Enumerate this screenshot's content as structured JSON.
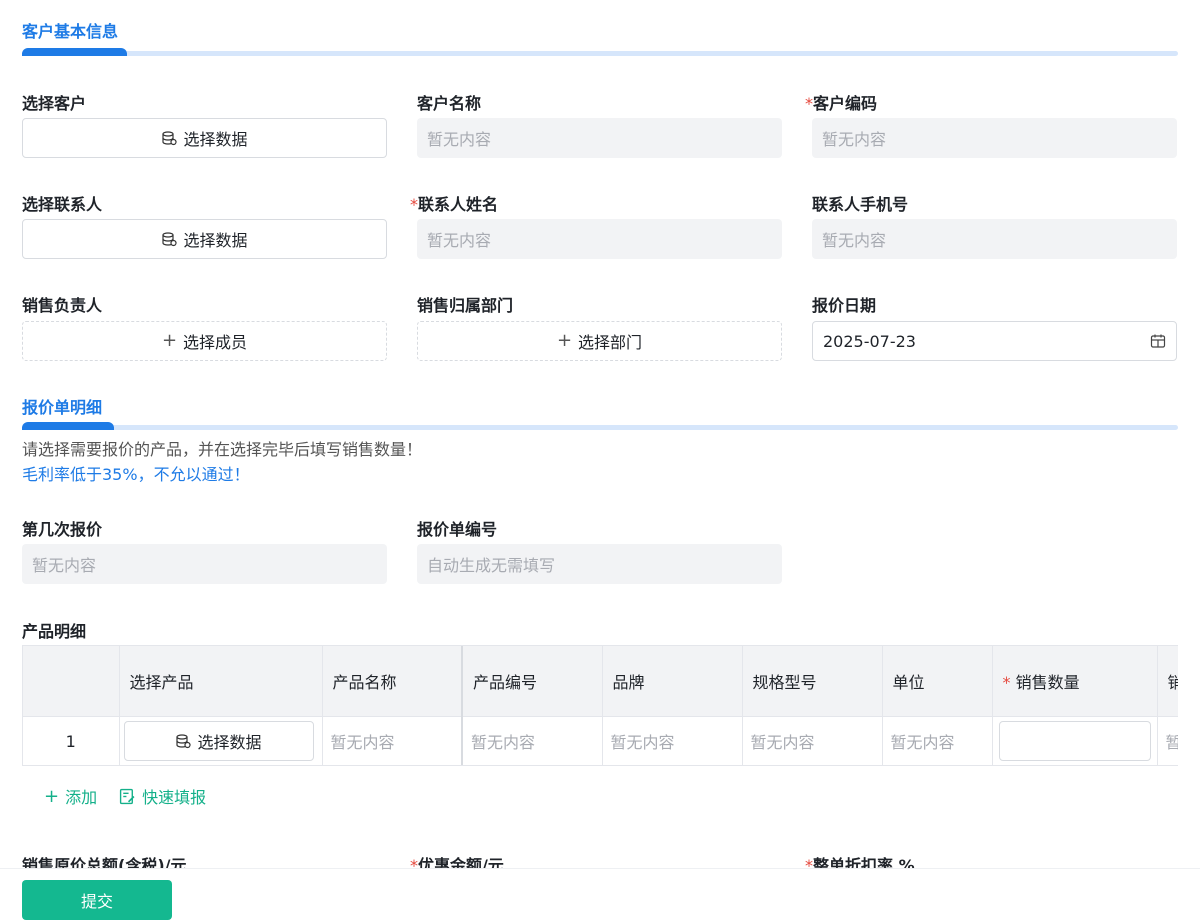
{
  "sections": {
    "basic": {
      "title": "客户基本信息"
    },
    "detail": {
      "title": "报价单明细"
    }
  },
  "fields": {
    "select_customer": {
      "label": "选择客户",
      "button": "选择数据"
    },
    "customer_name": {
      "label": "客户名称",
      "value": "暂无内容"
    },
    "customer_code": {
      "required": "*",
      "label": "客户编码",
      "value": "暂无内容"
    },
    "select_contact": {
      "label": "选择联系人",
      "button": "选择数据"
    },
    "contact_name": {
      "required": "*",
      "label": "联系人姓名",
      "value": "暂无内容"
    },
    "contact_phone": {
      "label": "联系人手机号",
      "value": "暂无内容"
    },
    "sales_owner": {
      "label": "销售负责人",
      "button": "选择成员"
    },
    "sales_dept": {
      "label": "销售归属部门",
      "button": "选择部门"
    },
    "quote_date": {
      "label": "报价日期",
      "value": "2025-07-23"
    },
    "quote_round": {
      "label": "第几次报价",
      "value": "暂无内容"
    },
    "quote_no": {
      "label": "报价单编号",
      "value": "自动生成无需填写"
    }
  },
  "hints": {
    "line1": "请选择需要报价的产品，并在选择完毕后填写销售数量！",
    "line2": "毛利率低于35%，不允以通过！"
  },
  "products": {
    "label": "产品明细",
    "columns": [
      "",
      "选择产品",
      "产品名称",
      "产品编号",
      "品牌",
      "规格型号",
      "单位",
      "销售数量",
      "销"
    ],
    "required_mark": "*",
    "row": {
      "index": "1",
      "select_button": "选择数据",
      "name": "暂无内容",
      "code": "暂无内容",
      "brand": "暂无内容",
      "spec": "暂无内容",
      "unit": "暂无内容",
      "next": "暂"
    },
    "add_label": "添加",
    "quick_fill_label": "快速填报"
  },
  "bottom_fields": {
    "original_total": "销售原价总额(含税)/元",
    "discount_amount": "优惠金额/元",
    "discount_rate": "整单折扣率 %"
  },
  "submit_label": "提交",
  "colors": {
    "accent": "#1e7be6",
    "green": "#14b890",
    "required": "#e5483d"
  }
}
